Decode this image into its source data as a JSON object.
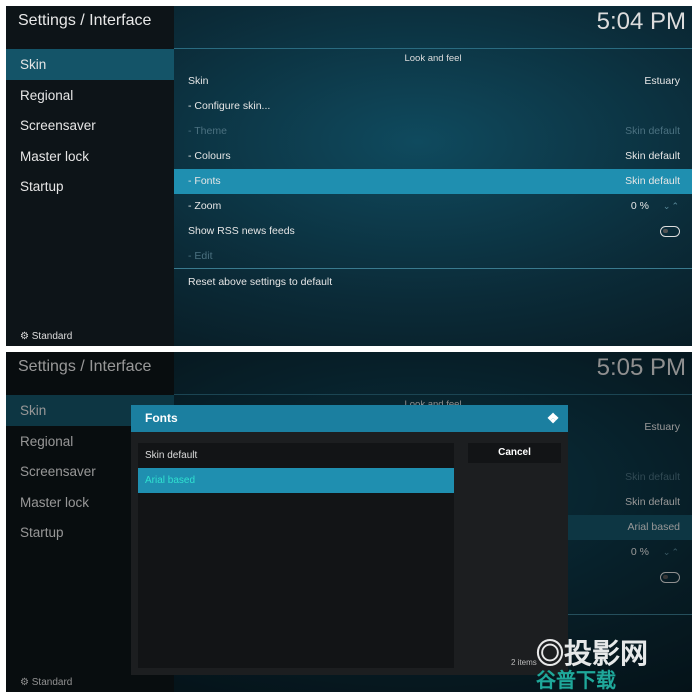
{
  "screens": [
    {
      "title": "Settings / Interface",
      "clock": "5:04 PM",
      "sidebar": [
        "Skin",
        "Regional",
        "Screensaver",
        "Master lock",
        "Startup"
      ],
      "section": "Look and feel",
      "rows": [
        {
          "label": "Skin",
          "value": "Estuary"
        },
        {
          "label": "- Configure skin...",
          "value": ""
        },
        {
          "label": "- Theme",
          "value": "Skin default"
        },
        {
          "label": "- Colours",
          "value": "Skin default"
        },
        {
          "label": "- Fonts",
          "value": "Skin default"
        },
        {
          "label": "- Zoom",
          "value": "0 %"
        },
        {
          "label": "Show RSS news feeds",
          "value": ""
        },
        {
          "label": "- Edit",
          "value": ""
        }
      ],
      "reset": "Reset above settings to default",
      "footer": "Standard"
    },
    {
      "title": "Settings / Interface",
      "clock": "5:05 PM",
      "sidebar": [
        "Skin",
        "Regional",
        "Screensaver",
        "Master lock",
        "Startup"
      ],
      "section": "Look and feel",
      "values": [
        "Estuary",
        "Skin default",
        "Skin default",
        "Arial based",
        "0 %"
      ],
      "footer": "Standard",
      "dialog": {
        "title": "Fonts",
        "options": [
          "Skin default",
          "Arial based"
        ],
        "selected": "Arial based",
        "cancel": "Cancel",
        "count": "2 items"
      }
    }
  ],
  "watermark": {
    "text": "投影网",
    "sub": "谷普下载"
  },
  "colors": {
    "accent": "#1f8fb0",
    "sidebar_selected": "#145468"
  }
}
